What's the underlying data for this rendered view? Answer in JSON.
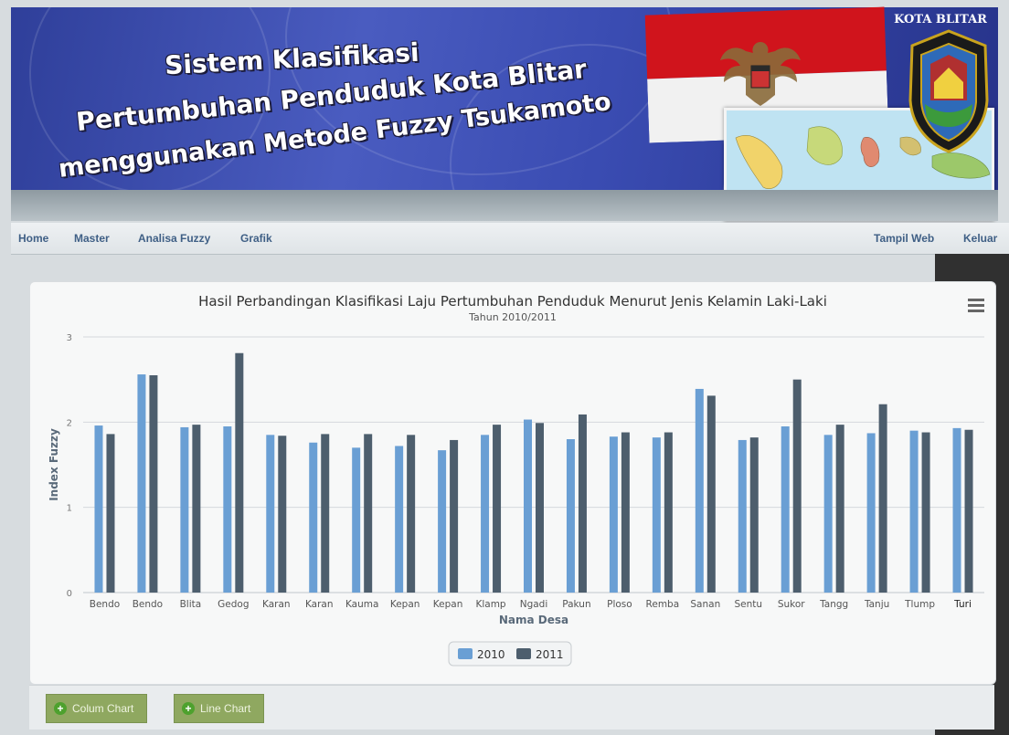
{
  "header": {
    "title_lines": [
      "Sistem Klasifikasi",
      "Pertumbuhan Penduduk Kota Blitar",
      "menggunakan Metode Fuzzy Tsukamoto"
    ],
    "city_label": "KOTA BLITAR"
  },
  "nav": {
    "left": [
      "Home",
      "Master",
      "Analisa Fuzzy",
      "Grafik"
    ],
    "right": [
      "Tampil Web",
      "Keluar"
    ]
  },
  "chart_data": {
    "type": "bar",
    "title": "Hasil Perbandingan Klasifikasi Laju Pertumbuhan Penduduk Menurut Jenis Kelamin Laki-Laki",
    "subtitle": "Tahun 2010/2011",
    "xlabel": "Nama Desa",
    "ylabel": "Index Fuzzy",
    "ylim": [
      0,
      3
    ],
    "yticks": [
      0,
      1,
      2,
      3
    ],
    "grid": true,
    "legend_position": "bottom-center",
    "categories": [
      "Bendo",
      "Bendo",
      "Blita",
      "Gedog",
      "Karan",
      "Karan",
      "Kauma",
      "Kepan",
      "Kepan",
      "Klamp",
      "Ngadi",
      "Pakun",
      "Ploso",
      "Remba",
      "Sanan",
      "Sentu",
      "Sukor",
      "Tangg",
      "Tanju",
      "Tlump",
      "Turi"
    ],
    "series": [
      {
        "name": "2010",
        "color": "#6a9fd4",
        "values": [
          1.96,
          2.56,
          1.94,
          1.95,
          1.85,
          1.76,
          1.7,
          1.72,
          1.67,
          1.85,
          2.03,
          1.8,
          1.83,
          1.82,
          2.39,
          1.79,
          1.95,
          1.85,
          1.87,
          1.9,
          1.93
        ]
      },
      {
        "name": "2011",
        "color": "#4d5e6d",
        "values": [
          1.86,
          2.55,
          1.97,
          2.81,
          1.84,
          1.86,
          1.86,
          1.85,
          1.79,
          1.97,
          1.99,
          2.09,
          1.88,
          1.88,
          2.31,
          1.82,
          2.5,
          1.97,
          2.21,
          1.88,
          1.91
        ]
      }
    ]
  },
  "footer": {
    "buttons": [
      "Colum Chart",
      "Line Chart"
    ]
  }
}
